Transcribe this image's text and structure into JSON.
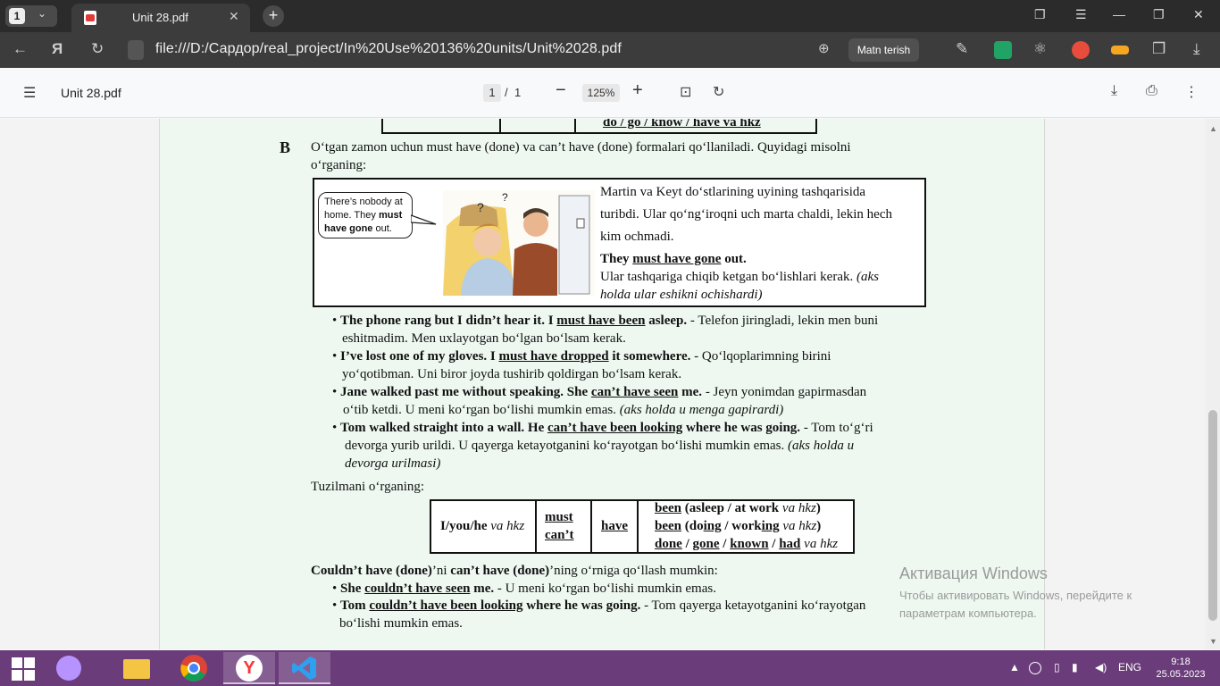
{
  "browser": {
    "tab_count": "1",
    "tab_title": "Unit 28.pdf",
    "url": "file:///D:/Сардор/real_project/In%20Use%20136%20units/Unit%2028.pdf",
    "translate_button": "Matn terish"
  },
  "pdf_toolbar": {
    "title": "Unit 28.pdf",
    "page_current": "1",
    "page_separator": "/",
    "page_total": "1",
    "zoom": "125%"
  },
  "page": {
    "top_table_text": "do / go / know / have va hkz",
    "section_letter": "B",
    "intro_line1": "O‘tgan zamon uchun must have (done) va can’t have (done) formalari qo‘llaniladi. Quyidagi misolni",
    "intro_line2": "o‘rganing:",
    "bubble": {
      "line1": "There’s nobody at",
      "line2": "home.  They ",
      "line2_bold": "must",
      "line3_bold": "have gone",
      "line3": " out."
    },
    "box": {
      "line1": "Martin va Keyt do‘stlarining uyining tashqarisida",
      "line2": "turibdi. Ular qo‘ng‘iroqni uch marta chaldi, lekin hech",
      "line3": "kim ochmadi.",
      "line4_a": "They ",
      "line4_u": "must have gone",
      "line4_b": " out.",
      "line5_a": "Ular tashqariga chiqib ketgan bo‘lishlari kerak. ",
      "line5_i": "(aks",
      "line6_i": "holda ular eshikni  ochishardi)"
    },
    "bullets": [
      {
        "b1": "The phone rang but I didn’t hear it. I ",
        "u": "must have been",
        "b2": " asleep.",
        "t": " - Telefon jiringladi, lekin men buni",
        "line2": "eshitmadim. Men uxlayotgan bo‘lgan bo‘lsam kerak.",
        "i": ""
      },
      {
        "b1": "I’ve lost one of my gloves. I ",
        "u": "must have dropped",
        "b2": " it somewhere.",
        "t": " - Qo‘lqoplarimning birini",
        "line2": "yo‘qotibman. Uni biror joyda tushirib qoldirgan bo‘lsam kerak.",
        "i": ""
      },
      {
        "b1": "Jane walked past me without speaking. She ",
        "u": "can’t have seen",
        "b2": " me.",
        "t": " - Jeyn yonimdan gapirmasdan",
        "line2": "o‘tib ketdi. U meni ko‘rgan bo‘lishi mumkin emas. ",
        "i": "(aks holda u menga gapirardi)"
      },
      {
        "b1": "Tom walked straight into a wall. He ",
        "u": "can’t have been looking",
        "b2": " where he was going.",
        "t": " - Tom to‘g‘ri",
        "line2": "devorga yurib urildi. U qayerga ketayotganini ko‘rayotgan bo‘lishi mumkin emas. ",
        "i": "(aks holda u",
        "line3": "devorga urilmasi)"
      }
    ],
    "structure_heading": "Tuzilmani o‘rganing:",
    "structure": {
      "subject": "I/you/he",
      "subject_i": "va  hkz",
      "modal1": "must",
      "modal2": "can’t",
      "have": "have",
      "r1_u": "been",
      "r1_b": " (asleep / at work ",
      "r1_i": "va hkz",
      "r1_end": ")",
      "r2_u": "been",
      "r2_a": " (do",
      "r2_u2": "ing",
      "r2_b": " / work",
      "r2_u3": "ing",
      "r2_i": " va hkz",
      "r2_end": ")",
      "r3_a": "done",
      "r3_b": "gone",
      "r3_c": "known",
      "r3_d": "had",
      "r3_i": " va hkz"
    },
    "couldnt_heading_b1": "Couldn’t have (done)",
    "couldnt_heading_t1": "’ni ",
    "couldnt_heading_b2": "can’t have (done)",
    "couldnt_heading_t2": "’ning o‘rniga qo‘llash mumkin:",
    "bullets2": [
      {
        "b1": "She ",
        "u": "couldn’t have seen",
        "b2": " me.",
        "t": " - U meni ko‘rgan bo‘lishi mumkin emas."
      },
      {
        "b1": "Tom ",
        "u": "couldn’t have been looking",
        "b2": " where he was going.",
        "t": " - Tom qayerga ketayotganini ko‘rayotgan",
        "line2": "bo‘lishi mumkin emas."
      }
    ]
  },
  "activation": {
    "title": "Активация Windows",
    "line1": "Чтобы активировать Windows, перейдите к",
    "line2": "параметрам компьютера."
  },
  "taskbar": {
    "lang": "ENG",
    "time": "9:18",
    "date": "25.05.2023"
  }
}
